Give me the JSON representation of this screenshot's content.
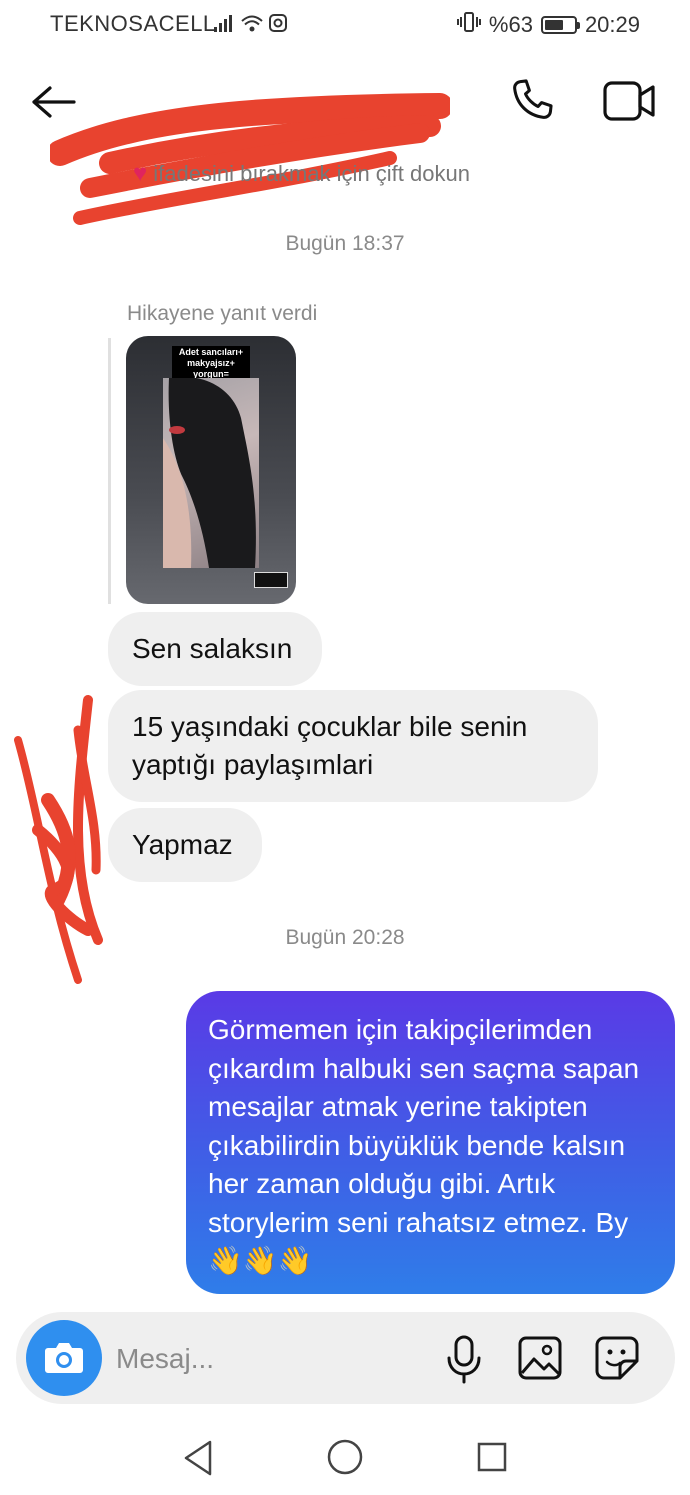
{
  "status_bar": {
    "carrier": "TEKNOSACELL",
    "battery": "%63",
    "battery_level": 0.63,
    "time": "20:29"
  },
  "header": {
    "hint": "ifadesini bırakmak için çift dokun",
    "icons": [
      "back-arrow-icon",
      "phone-icon",
      "video-camera-icon"
    ]
  },
  "thread": {
    "timestamp1": "Bugün 18:37",
    "reply_label": "Hikayene yanıt verdi",
    "story_caption": "Adet sancıları+ makyajsız+ yorgun=",
    "incoming": [
      "Sen salaksın",
      "15 yaşındaki çocuklar bile senin yaptığı paylaşımlari",
      "Yapmaz"
    ],
    "timestamp2": "Bugün 20:28",
    "outgoing": "Görmemen için takipçilerimden çıkardım halbuki sen saçma sapan  mesajlar atmak yerine takipten çıkabilirdin büyüklük bende kalsın her zaman olduğu gibi. Artık storylerim seni rahatsız etmez. By👋👋👋"
  },
  "composer": {
    "placeholder": "Mesaj..."
  },
  "colors": {
    "accent_blue": "#2f8fef",
    "outgoing_top": "#5a3ae6",
    "outgoing_bottom": "#2f7de9",
    "redaction": "#e8432f"
  }
}
